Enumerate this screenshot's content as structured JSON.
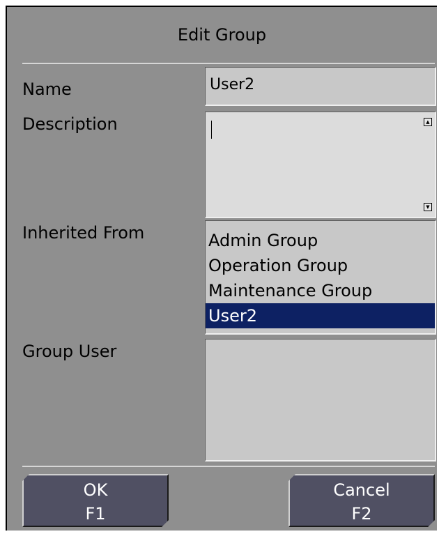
{
  "dialog": {
    "title": "Edit Group"
  },
  "fields": {
    "name_label": "Name",
    "name_value": "User2",
    "description_label": "Description",
    "description_value": "",
    "inherited_label": "Inherited From",
    "inherited_items": [
      "Admin Group",
      "Operation Group",
      "Maintenance Group",
      "User2"
    ],
    "inherited_selected": "User2",
    "group_user_label": "Group User"
  },
  "buttons": {
    "ok_label": "OK",
    "ok_key": "F1",
    "cancel_label": "Cancel",
    "cancel_key": "F2"
  },
  "colors": {
    "dialog_bg": "#8f8f8f",
    "field_bg": "#c8c8c8",
    "selection_bg": "#0d2163",
    "button_bg": "#505063"
  }
}
